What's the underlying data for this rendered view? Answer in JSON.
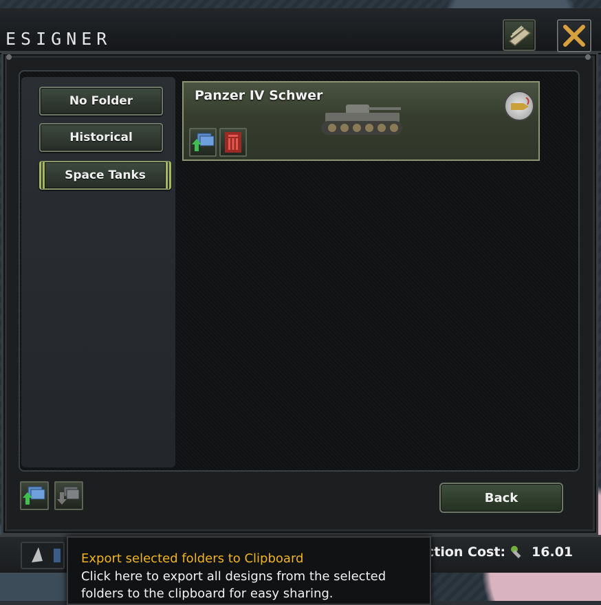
{
  "window": {
    "title": "ESIGNER"
  },
  "folders": [
    {
      "label": "No Folder",
      "selected": false
    },
    {
      "label": "Historical",
      "selected": false
    },
    {
      "label": "Space Tanks",
      "selected": true
    }
  ],
  "design_card": {
    "name": "Panzer IV Schwer"
  },
  "actions": {
    "back_label": "Back"
  },
  "cost": {
    "label": "ction Cost:",
    "value": "16.01"
  },
  "tooltip": {
    "title": "Export selected folders to Clipboard",
    "body_line1": "Click here to export all designs from the selected",
    "body_line2": "folders to the clipboard for easy sharing."
  },
  "colors": {
    "tooltip_title": "#f0b41f",
    "delete_red": "#c23b33",
    "export_green": "#3fbf4f"
  }
}
